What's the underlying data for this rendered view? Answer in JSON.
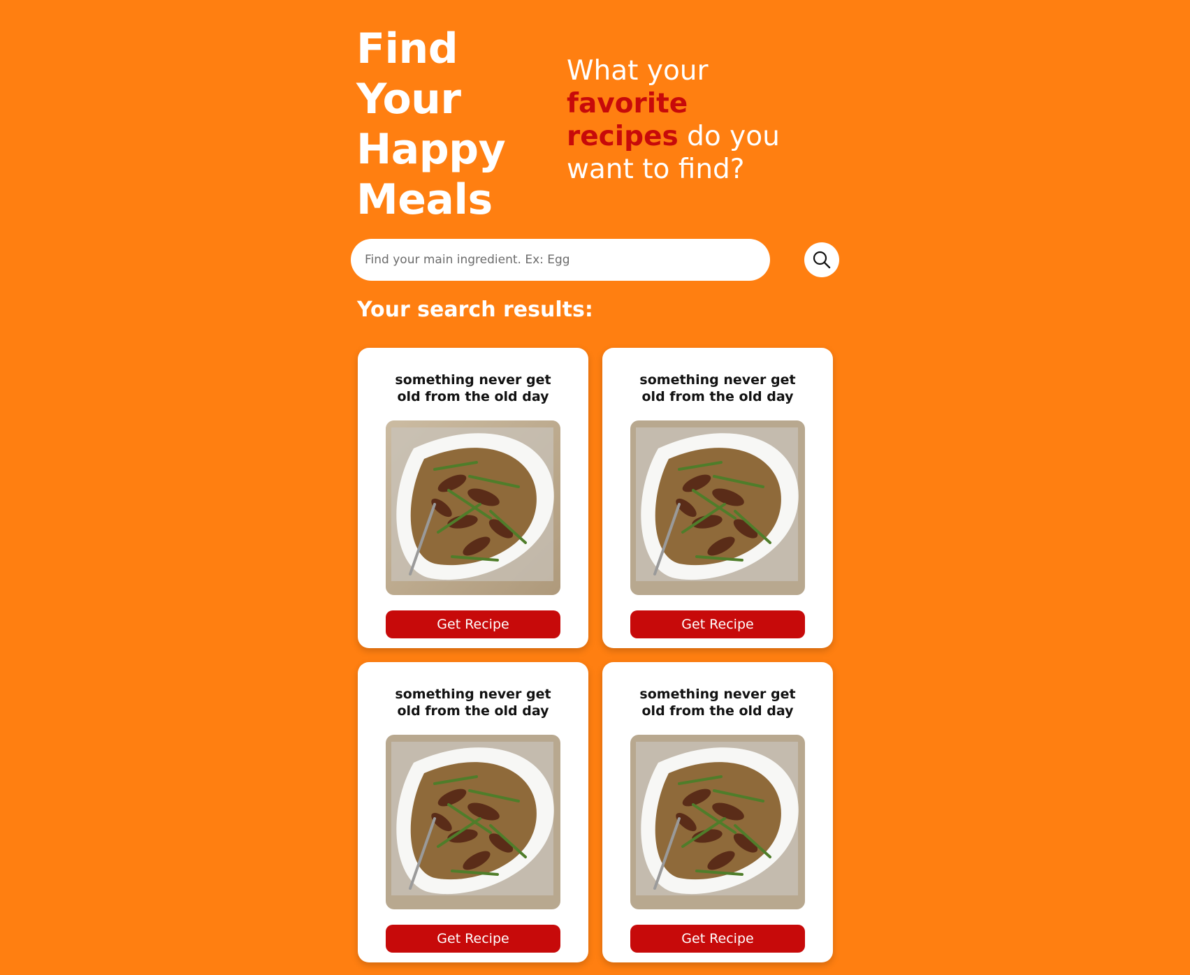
{
  "hero": {
    "title_lines": [
      "Find",
      "Your",
      "Happy",
      "Meals"
    ],
    "tagline_prefix": "What your",
    "tagline_accent_1": "favorite",
    "tagline_accent_2": "recipes",
    "tagline_suffix_1": "do you",
    "tagline_suffix_2": "want to find?"
  },
  "search": {
    "placeholder": "Find your main ingredient. Ex: Egg",
    "value": "",
    "button_icon": "search-icon"
  },
  "results": {
    "heading": "Your search results:",
    "items": [
      {
        "title": "something never get old from the old day",
        "image": "stir-fry-dish-photo",
        "button_label": "Get Recipe"
      },
      {
        "title": "something never get old from the old day",
        "image": "stir-fry-dish-photo",
        "button_label": "Get Recipe"
      },
      {
        "title": "something never get old from the old day",
        "image": "stir-fry-dish-photo",
        "button_label": "Get Recipe"
      },
      {
        "title": "something never get old from the old day",
        "image": "stir-fry-dish-photo",
        "button_label": "Get Recipe"
      }
    ]
  },
  "colors": {
    "background": "#FF7F11",
    "accent": "#C70A0A",
    "card": "#FFFFFF"
  }
}
